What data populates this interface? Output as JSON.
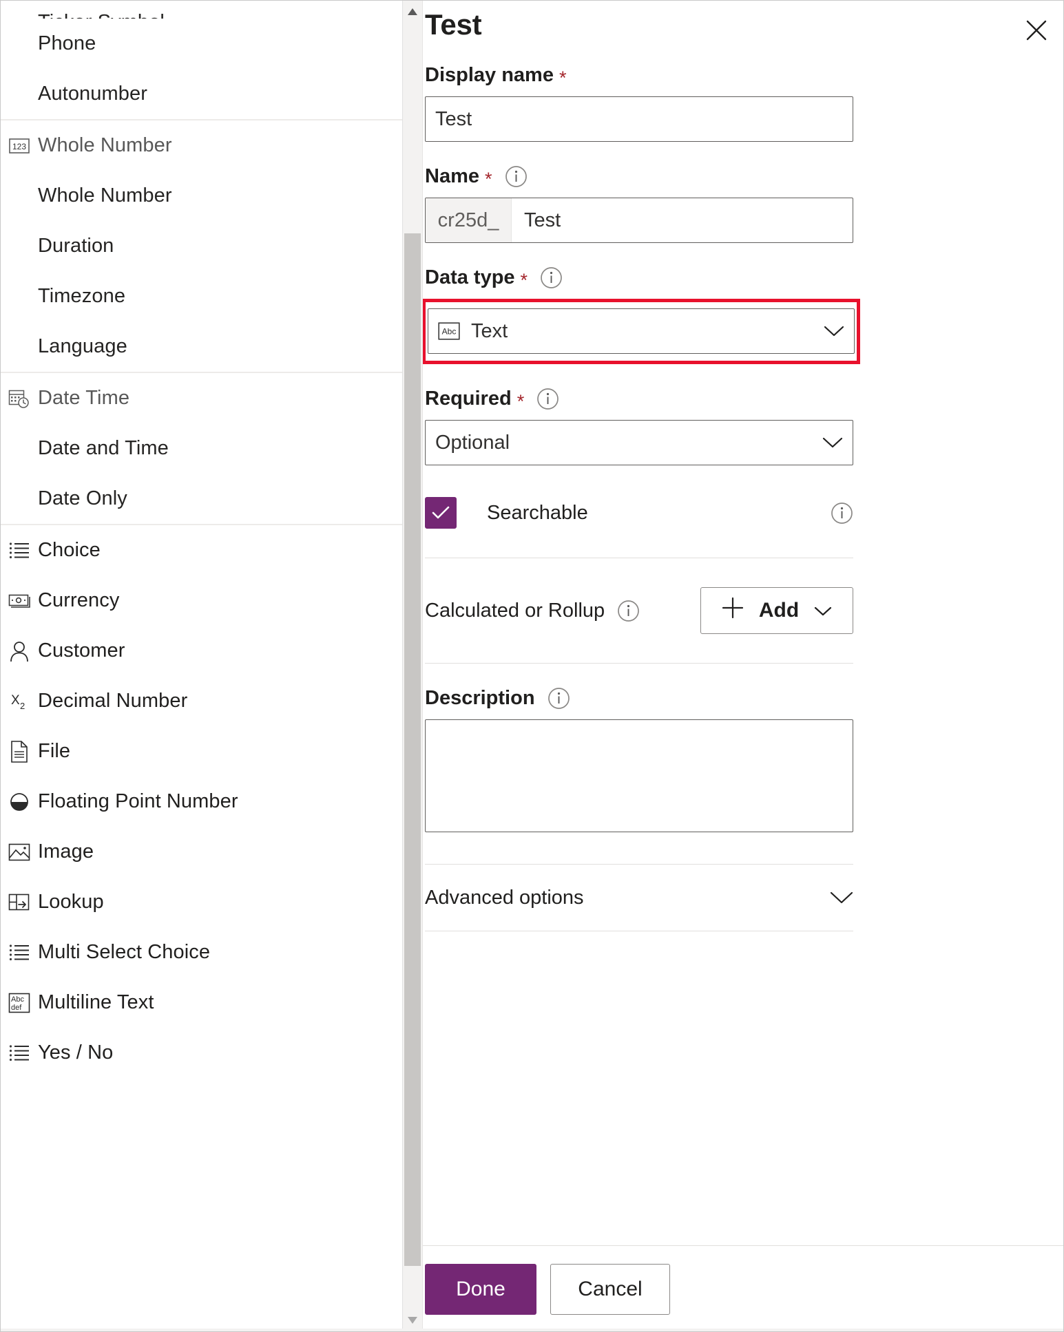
{
  "left_panel": {
    "groups": [
      {
        "header": null,
        "cut_off_item": "Ticker Symbol",
        "items": [
          {
            "label": "Phone",
            "icon": null
          },
          {
            "label": "Autonumber",
            "icon": null
          }
        ]
      },
      {
        "header": {
          "label": "Whole Number",
          "icon": "whole-number-icon"
        },
        "items": [
          {
            "label": "Whole Number",
            "icon": null
          },
          {
            "label": "Duration",
            "icon": null
          },
          {
            "label": "Timezone",
            "icon": null
          },
          {
            "label": "Language",
            "icon": null
          }
        ]
      },
      {
        "header": {
          "label": "Date Time",
          "icon": "date-time-icon"
        },
        "items": [
          {
            "label": "Date and Time",
            "icon": null
          },
          {
            "label": "Date Only",
            "icon": null
          }
        ]
      },
      {
        "header": null,
        "items": [
          {
            "label": "Choice",
            "icon": "choice-list-icon",
            "top": true
          },
          {
            "label": "Currency",
            "icon": "currency-icon",
            "top": true
          },
          {
            "label": "Customer",
            "icon": "person-icon",
            "top": true
          },
          {
            "label": "Decimal Number",
            "icon": "subscript-x2-icon",
            "top": true
          },
          {
            "label": "File",
            "icon": "file-document-icon",
            "top": true
          },
          {
            "label": "Floating Point Number",
            "icon": "half-filled-circle-icon",
            "top": true
          },
          {
            "label": "Image",
            "icon": "image-picture-icon",
            "top": true
          },
          {
            "label": "Lookup",
            "icon": "lookup-table-arrow-icon",
            "top": true
          },
          {
            "label": "Multi Select Choice",
            "icon": "choice-list-icon",
            "top": true
          },
          {
            "label": "Multiline Text",
            "icon": "abc-def-multiline-icon",
            "top": true
          },
          {
            "label": "Yes / No",
            "icon": "choice-list-icon",
            "top": true
          }
        ]
      }
    ]
  },
  "scrollbars": {
    "panel_scroll_up_icon": "triangle-up-icon",
    "panel_scroll_down_icon": "triangle-down-icon"
  },
  "panel": {
    "title": "Test",
    "close_icon": "close-icon",
    "display_name": {
      "label": "Display name",
      "required_marker": "*",
      "value": "Test"
    },
    "name": {
      "label": "Name",
      "required_marker": "*",
      "info_icon": "info-icon",
      "prefix": "cr25d_",
      "value": "Test"
    },
    "data_type": {
      "label": "Data type",
      "required_marker": "*",
      "info_icon": "info-icon",
      "value": "Text",
      "value_icon": "abc-text-icon",
      "chevron_icon": "chevron-down-icon",
      "highlight_color": "#e8112d"
    },
    "required": {
      "label": "Required",
      "required_marker": "*",
      "info_icon": "info-icon",
      "value": "Optional",
      "chevron_icon": "chevron-down-icon"
    },
    "searchable": {
      "label": "Searchable",
      "checked": true,
      "check_icon": "checkmark-icon",
      "info_icon": "info-icon",
      "accent_color": "#742774"
    },
    "calculated_or_rollup": {
      "label": "Calculated or Rollup",
      "info_icon": "info-icon",
      "add_label": "Add",
      "add_plus_icon": "plus-icon",
      "add_chevron_icon": "chevron-down-icon"
    },
    "description": {
      "label": "Description",
      "info_icon": "info-icon",
      "value": ""
    },
    "advanced_options": {
      "label": "Advanced options",
      "chevron_icon": "chevron-down-icon"
    },
    "footer": {
      "done_label": "Done",
      "cancel_label": "Cancel",
      "primary_color": "#742774"
    }
  }
}
